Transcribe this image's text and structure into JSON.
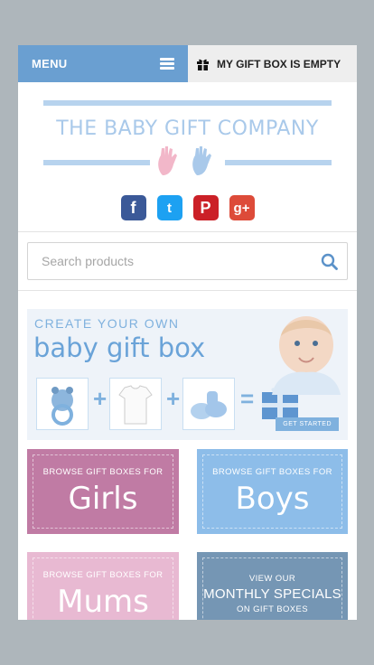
{
  "colors": {
    "menu_blue": "#6a9fd1",
    "page_bg": "#aeb6bb"
  },
  "header": {
    "menu_label": "MENU",
    "giftbox_label": "MY GIFT BOX IS EMPTY"
  },
  "logo": {
    "title": "THE BABY GIFT COMPANY"
  },
  "social": [
    {
      "name": "facebook",
      "glyph": "f",
      "color": "#3b5998"
    },
    {
      "name": "twitter",
      "glyph": "t",
      "color": "#1da1f2"
    },
    {
      "name": "pinterest",
      "glyph": "P",
      "color": "#cb2027"
    },
    {
      "name": "google-plus",
      "glyph": "g+",
      "color": "#dd4b39"
    }
  ],
  "search": {
    "placeholder": "Search products"
  },
  "banner": {
    "line1": "CREATE YOUR OWN",
    "line2": "baby gift box",
    "cta": "GET STARTED"
  },
  "tiles": [
    {
      "small": "BROWSE GIFT BOXES FOR",
      "big": "Girls",
      "color": "#c07ba4"
    },
    {
      "small": "BROWSE GIFT BOXES FOR",
      "big": "Boys",
      "color": "#8dbde9"
    },
    {
      "small": "BROWSE GIFT BOXES FOR",
      "big": "Mums",
      "color": "#e8b9d2"
    },
    {
      "small": "VIEW OUR",
      "mid": "MONTHLY SPECIALS",
      "small2": "ON GIFT BOXES",
      "color": "#7596b4"
    }
  ]
}
